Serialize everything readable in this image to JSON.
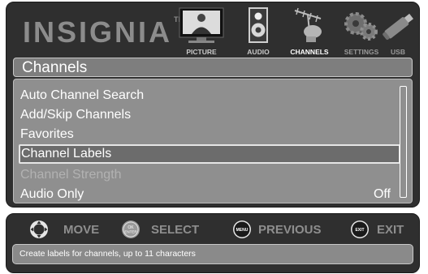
{
  "brand": {
    "name": "INSIGNIA",
    "tm": "TM"
  },
  "categories": [
    {
      "label": "PICTURE",
      "icon": "picture-icon"
    },
    {
      "label": "AUDIO",
      "icon": "speaker-icon"
    },
    {
      "label": "CHANNELS",
      "icon": "antenna-icon",
      "active": true
    },
    {
      "label": "SETTINGS",
      "icon": "gears-icon"
    },
    {
      "label": "USB",
      "icon": "usb-drive-icon"
    }
  ],
  "menu": {
    "title": "Channels",
    "items": [
      {
        "label": "Auto Channel Search"
      },
      {
        "label": "Add/Skip Channels"
      },
      {
        "label": "Favorites"
      },
      {
        "label": "Channel Labels",
        "selected": true
      },
      {
        "label": "Channel Strength",
        "disabled": true
      },
      {
        "label": "Audio Only",
        "value": "Off"
      }
    ]
  },
  "help": {
    "move": "MOVE",
    "select": "SELECT",
    "previous": "PREVIOUS",
    "exit": "EXIT",
    "ok_icon_line1": "OK",
    "ok_icon_line2": "ENTER",
    "menu_icon": "MENU",
    "exit_icon": "EXIT",
    "description": "Create labels for channels, up to 11 characters"
  },
  "colors": {
    "panel": "#2f2f2f",
    "menu_bg": "#8f8f8f",
    "highlight": "#6c6c6c",
    "hint_text": "#8e8e8e"
  }
}
